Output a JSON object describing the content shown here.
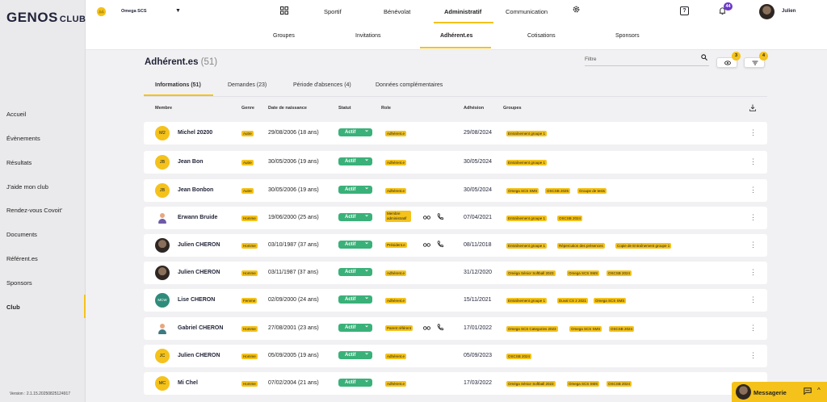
{
  "sidebar": {
    "logo": "GENOS",
    "logo_suffix": "CLUBS",
    "items": [
      {
        "label": "Accueil"
      },
      {
        "label": "Évènements"
      },
      {
        "label": "Résultats"
      },
      {
        "label": "J'aide mon club"
      },
      {
        "label": "Rendez-vous Covoit'"
      },
      {
        "label": "Documents"
      },
      {
        "label": "Référent.es"
      },
      {
        "label": "Sponsors"
      },
      {
        "label": "Club",
        "active": true
      }
    ],
    "version": "Version : 2.1.15.20250825124917"
  },
  "topbar": {
    "club_name": "Omega SCS",
    "nav": [
      "Sportif",
      "Bénévolat",
      "Administratif",
      "Communication"
    ],
    "active_nav": "Administratif",
    "notifications_count": "44",
    "user_name": "Julien"
  },
  "subnav": {
    "items": [
      "Groupes",
      "Invitations",
      "Adhérent.es",
      "Cotisations",
      "Sponsors"
    ],
    "active": "Adhérent.es"
  },
  "page": {
    "title": "Adhérent.es",
    "count": "(51)",
    "filter_placeholder": "Filtre",
    "visibility_badge": "3",
    "filter_badge": "4"
  },
  "tabs": [
    "Informations (51)",
    "Demandes (23)",
    "Période d'absences (4)",
    "Données complémentaires"
  ],
  "columns": [
    "Membre",
    "Genre",
    "Date de naissance",
    "Statut",
    "Role",
    "Adhésion",
    "Groupes"
  ],
  "members": [
    {
      "initials": "M2",
      "name": "Michel 20200",
      "genre": "Autre",
      "birth": "29/08/2006 (18 ans)",
      "status": "Actif",
      "role": "Adhérent.e",
      "adhesion": "29/08/2024",
      "groups": [
        "Entraînement groupe 1"
      ]
    },
    {
      "initials": "JB",
      "name": "Jean Bon",
      "genre": "Autre",
      "birth": "30/05/2006 (19 ans)",
      "status": "Actif",
      "role": "Adhérent.e",
      "adhesion": "30/05/2024",
      "groups": [
        "Entraînement groupe 1"
      ]
    },
    {
      "initials": "JB",
      "name": "Jean Bonbon",
      "genre": "Autre",
      "birth": "30/05/2006 (19 ans)",
      "status": "Actif",
      "role": "Adhérent.e",
      "adhesion": "30/05/2024",
      "groups": [
        "Omega SCS SMS",
        "OSCSB 2025",
        "Groupe de tests"
      ]
    },
    {
      "initials": "",
      "name": "Erwann Bruide",
      "genre": "Homme",
      "birth": "19/06/2000 (25 ans)",
      "status": "Actif",
      "role": "Membre administratif",
      "adhesion": "07/04/2021",
      "groups": [
        "Entraînement groupe 1",
        "OSCSB 2024"
      ]
    },
    {
      "initials": "",
      "name": "Julien CHERON",
      "genre": "Homme",
      "birth": "03/10/1987 (37 ans)",
      "status": "Actif",
      "role": "Président.e",
      "adhesion": "08/11/2018",
      "groups": [
        "Entraînement groupe 1",
        "Répercution des présences",
        "Copie de Entraînement groupe 1"
      ]
    },
    {
      "initials": "",
      "name": "Julien CHERON",
      "genre": "Homme",
      "birth": "03/11/1987 (37 ans)",
      "status": "Actif",
      "role": "Adhérent.e",
      "adhesion": "31/12/2020",
      "groups": [
        "Oméga Sénior Softball 2023",
        "Omega SCS SMS",
        "OSCSB 2024"
      ]
    },
    {
      "initials": "MCW",
      "name": "Lise CHERON",
      "genre": "Femme",
      "birth": "02/09/2000 (24 ans)",
      "status": "Actif",
      "role": "Adhérent.e",
      "adhesion": "15/11/2021",
      "groups": [
        "Entraînement groupe 1",
        "Duval CS 2 2021",
        "Omega SCS SMS"
      ]
    },
    {
      "initials": "",
      "name": "Gabriel CHERON",
      "genre": "Homme",
      "birth": "27/08/2001 (23 ans)",
      "status": "Actif",
      "role": "Parent référent",
      "adhesion": "17/01/2022",
      "groups": [
        "Omega SCS Categories 2023",
        "Omega SCS SMS",
        "OSCSB 2024"
      ]
    },
    {
      "initials": "JC",
      "name": "Julien CHERON",
      "genre": "Homme",
      "birth": "05/09/2005 (19 ans)",
      "status": "Actif",
      "role": "Adhérent.e",
      "adhesion": "05/09/2023",
      "groups": [
        "OSCSB 2024"
      ]
    },
    {
      "initials": "MC",
      "name": "Mi Chel",
      "genre": "Homme",
      "birth": "07/02/2004 (21 ans)",
      "status": "Actif",
      "role": "Adhérent.e",
      "adhesion": "17/03/2022",
      "groups": [
        "Oméga Sénior Softball 2023",
        "Omega SCS SMS",
        "OSCSB 2024"
      ]
    }
  ],
  "messagerie": {
    "label": "Messagerie"
  },
  "colors": {
    "accent": "#f4c21a",
    "status": "#3ab179",
    "badge": "#6a39c9"
  },
  "icons": [
    "grid-icon",
    "gear-icon",
    "help-icon",
    "bell-icon",
    "search-icon",
    "eye-icon",
    "filter-icon",
    "download-icon",
    "glasses-icon",
    "phone-icon",
    "more-icon",
    "chat-icon"
  ]
}
